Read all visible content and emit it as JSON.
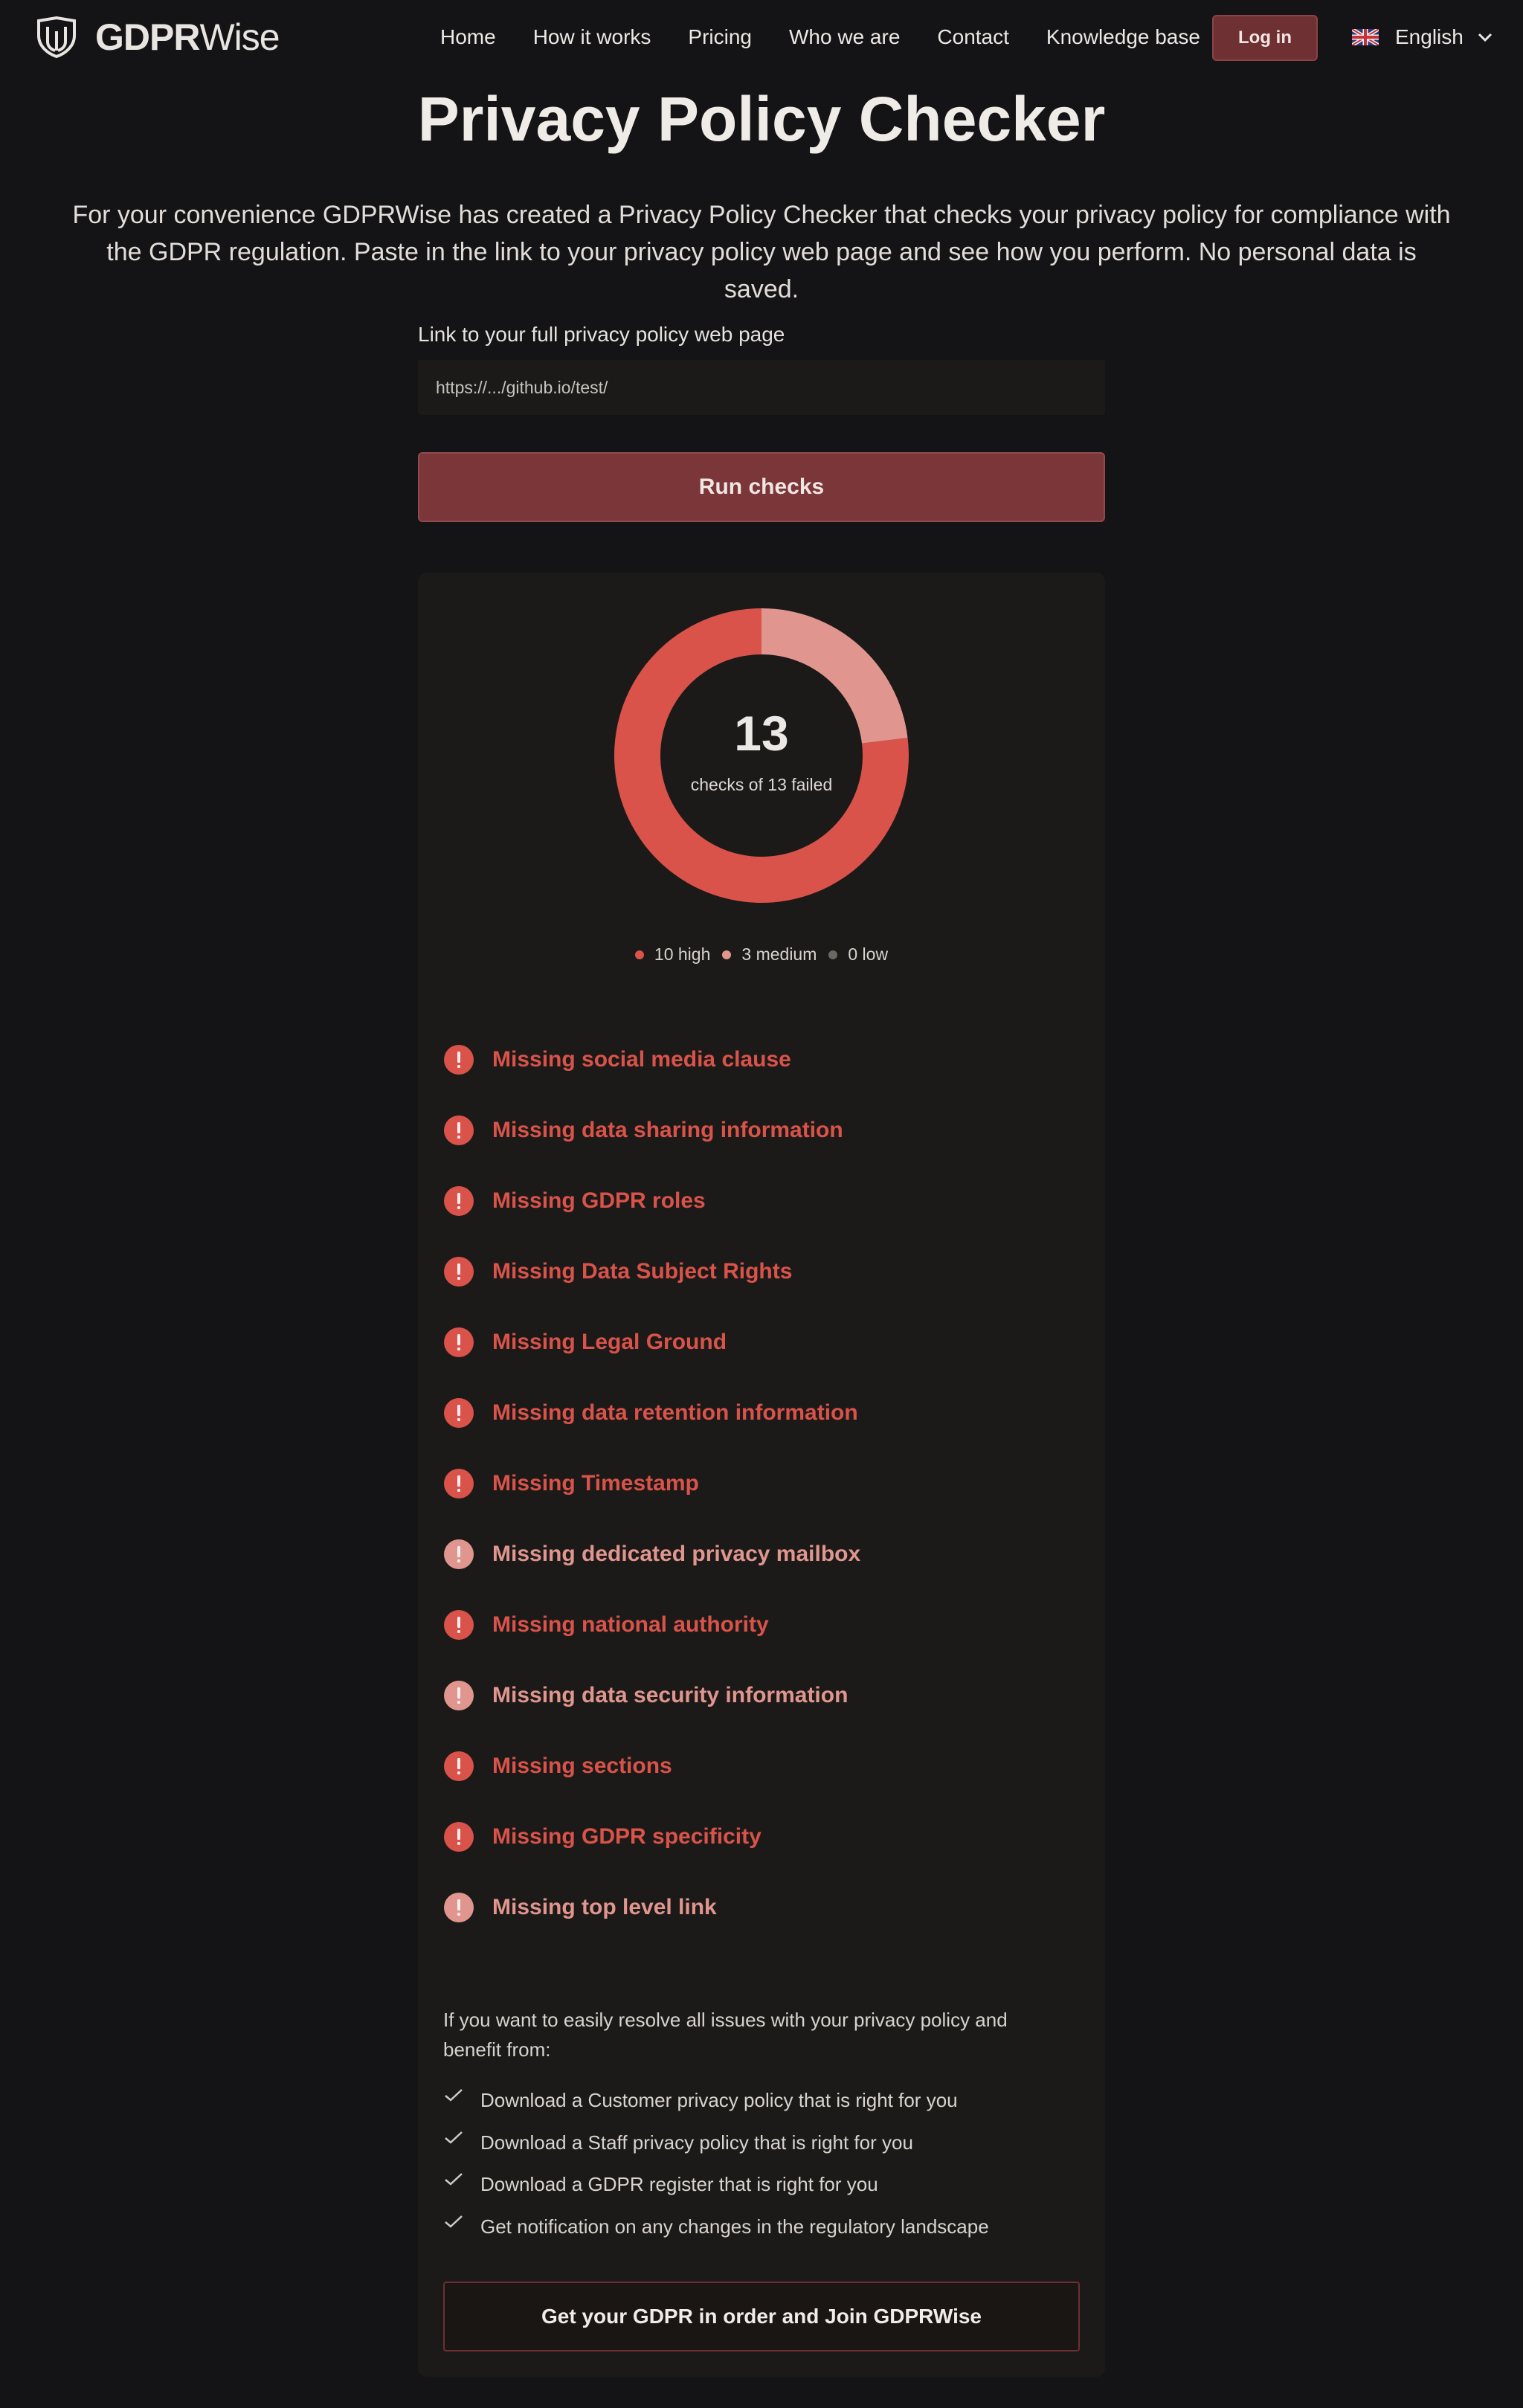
{
  "brand": {
    "name_bold": "GDPR",
    "name_light": "Wise"
  },
  "nav": {
    "links": [
      "Home",
      "How it works",
      "Pricing",
      "Who we are",
      "Contact",
      "Knowledge base"
    ],
    "login": "Log in",
    "language": "English"
  },
  "hero": {
    "title": "Privacy Policy Checker",
    "intro": "For your convenience GDPRWise has created a Privacy Policy Checker that checks your privacy policy for compliance with the GDPR regulation. Paste in the link to your privacy policy web page and see how you perform. No personal data is saved."
  },
  "form": {
    "label": "Link to your full privacy policy web page",
    "url_value": "https://.../github.io/test/",
    "run_button": "Run checks"
  },
  "result": {
    "failed_count": "13",
    "summary": "checks of 13 failed",
    "breakdown": [
      {
        "label": "10 high",
        "value": 10,
        "color": "#d9534a"
      },
      {
        "label": "3 medium",
        "value": 3,
        "color": "#e0968f"
      },
      {
        "label": "0 low",
        "value": 0,
        "color": "#6b6763"
      }
    ],
    "issues": [
      {
        "label": "Missing social media clause",
        "severity": "high"
      },
      {
        "label": "Missing data sharing information",
        "severity": "high"
      },
      {
        "label": "Missing GDPR roles",
        "severity": "high"
      },
      {
        "label": "Missing Data Subject Rights",
        "severity": "high"
      },
      {
        "label": "Missing Legal Ground",
        "severity": "high"
      },
      {
        "label": "Missing data retention information",
        "severity": "high"
      },
      {
        "label": "Missing Timestamp",
        "severity": "high"
      },
      {
        "label": "Missing dedicated privacy mailbox",
        "severity": "medium"
      },
      {
        "label": "Missing national authority",
        "severity": "high"
      },
      {
        "label": "Missing data security information",
        "severity": "medium"
      },
      {
        "label": "Missing sections",
        "severity": "high"
      },
      {
        "label": "Missing GDPR specificity",
        "severity": "high"
      },
      {
        "label": "Missing top level link",
        "severity": "medium"
      }
    ],
    "severity_colors": {
      "high": "#d9534a",
      "medium": "#e0968f"
    },
    "cta_text": "If you want to easily resolve all issues with your privacy policy and benefit from:",
    "benefits": [
      "Download a Customer privacy policy that is right for you",
      "Download a Staff privacy policy that is right for you",
      "Download a GDPR register that is right for you",
      "Get notification on any changes in the regulatory landscape"
    ],
    "join_button": "Get your GDPR in order and Join GDPRWise"
  },
  "icons": {
    "logo": "shield-logo-icon",
    "flag": "uk-flag-icon",
    "chevron": "chevron-down-icon",
    "issue": "exclamation-circle-icon",
    "benefit": "check-icon"
  }
}
